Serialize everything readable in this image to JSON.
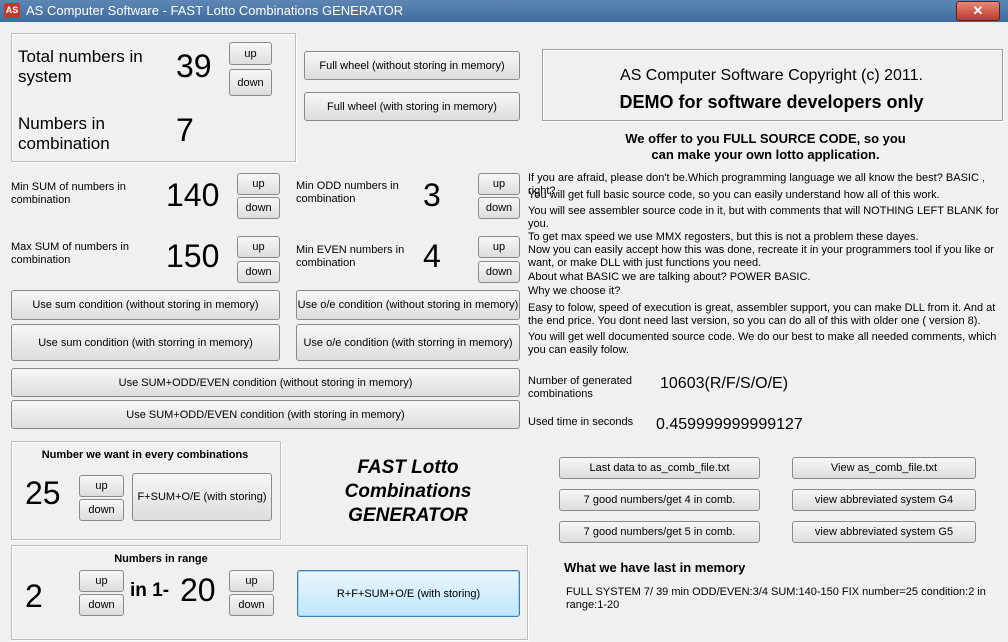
{
  "window": {
    "title": "AS Computer Software - FAST Lotto Combinations GENERATOR",
    "icon_text": "AS",
    "close": "✕"
  },
  "system": {
    "total_label": "Total numbers in system",
    "total_value": "39",
    "combination_label": "Numbers in combination",
    "combination_value": "7",
    "up": "up",
    "down": "down"
  },
  "full_wheel": {
    "without_storing": "Full wheel (without storing in memory)",
    "with_storing": "Full wheel (with storing in memory)"
  },
  "copyright": {
    "line1": "AS Computer Software Copyright (c) 2011.",
    "line2": "DEMO for software developers only"
  },
  "offer": {
    "line1": "We offer to you FULL SOURCE CODE, so you",
    "line2": "can make your own lotto application.",
    "paragraphs": [
      "If you are afraid, please don't be.Which programming language we all know the best? BASIC , right?",
      "You will get full basic source code, so you can easily understand how all of this work.",
      "You will see assembler source code in it, but with comments that will NOTHING LEFT BLANK for you.",
      "To get max speed we use MMX regosters, but this is not a problem these dayes.",
      "Now you can easily accept how this was done, recreate it in your programmers tool if you like or want, or make DLL with just functions you need.",
      "About what BASIC we are talking about? POWER BASIC.",
      "Why we choose it?",
      "Easy to folow, speed of execution is great, assembler support, you can make DLL from it. And at the end price. You dont need last version, so you can do all of this with older one ( version 8).",
      "You will get well documented source code. We do our best to make all needed comments, which you can easily folow."
    ]
  },
  "sum": {
    "min_label": "Min SUM of numbers in combination",
    "min_value": "140",
    "max_label": "Max SUM of numbers in combination",
    "max_value": "150",
    "without_storing": "Use sum condition (without storing in memory)",
    "with_storing": "Use sum condition (with storring in memory)"
  },
  "odd_even": {
    "min_odd_label": "Min ODD numbers in combination",
    "min_odd_value": "3",
    "min_even_label": "Min EVEN numbers in combination",
    "min_even_value": "4",
    "without_storing": "Use o/e condition (without storing in memory)",
    "with_storing": "Use o/e condition (with storring in memory)"
  },
  "combined": {
    "without_storing": "Use SUM+ODD/EVEN condition (without storing in memory)",
    "with_storing": "Use SUM+ODD/EVEN condition (with storing in memory)"
  },
  "stats": {
    "generated_label": "Number of generated combinations",
    "generated_value": "10603(R/F/S/O/E)",
    "time_label": "Used time in seconds",
    "time_value": "0.459999999999127"
  },
  "fixed": {
    "title": "Number we want in every combinations",
    "value": "25",
    "button": "F+SUM+O/E (with storing)"
  },
  "logo": {
    "line1": "FAST Lotto",
    "line2": "Combinations",
    "line3": "GENERATOR"
  },
  "range": {
    "title": "Numbers in range",
    "count_value": "2",
    "in_label": "in 1-",
    "max_value": "20",
    "button": "R+F+SUM+O/E (with storing)"
  },
  "files": {
    "last_data": "Last data to as_comb_file.txt",
    "view_file": "View as_comb_file.txt",
    "good4": "7 good numbers/get 4 in comb.",
    "view_g4": "view abbreviated system G4",
    "good5": "7 good numbers/get 5 in comb.",
    "view_g5": "view abbreviated system G5"
  },
  "memory": {
    "title": "What we have last in memory",
    "text": "FULL SYSTEM 7/ 39 min ODD/EVEN:3/4 SUM:140-150 FIX number=25 condition:2 in range:1-20"
  }
}
